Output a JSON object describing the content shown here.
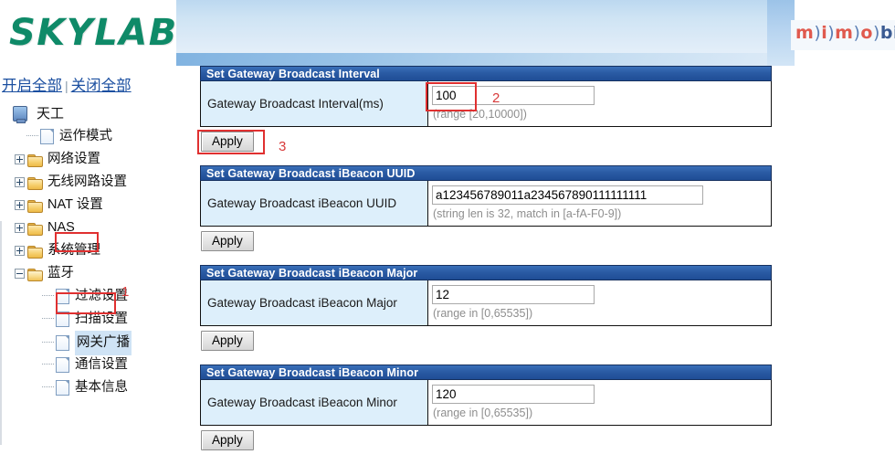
{
  "header": {
    "brand": "SKYLAB",
    "secondary_logo_text": "m)i)m)o)bi",
    "secondary_logo_parts": {
      "m1": "m",
      "p1": ")",
      "i": "i",
      "p2": ")",
      "m2": "m",
      "p3": ")",
      "o": "o",
      "p4": ")",
      "tail": "bi"
    }
  },
  "sidebar": {
    "expand_all_label": "开启全部",
    "separator": "|",
    "collapse_all_label": "关闭全部",
    "root": {
      "label": "天工",
      "icon": "computer-icon"
    },
    "items": [
      {
        "label": "运作模式",
        "icon": "page-icon",
        "level": 1,
        "expander": "none"
      },
      {
        "label": "网络设置",
        "icon": "folder-icon",
        "level": 1,
        "expander": "plus"
      },
      {
        "label": "无线网路设置",
        "icon": "folder-icon",
        "level": 1,
        "expander": "plus"
      },
      {
        "label": "NAT 设置",
        "icon": "folder-icon",
        "level": 1,
        "expander": "plus"
      },
      {
        "label": "NAS",
        "icon": "folder-icon",
        "level": 1,
        "expander": "plus"
      },
      {
        "label": "系统管理",
        "icon": "folder-icon",
        "level": 1,
        "expander": "plus"
      },
      {
        "label": "蓝牙",
        "icon": "folder-open-icon",
        "level": 1,
        "expander": "minus"
      },
      {
        "label": "过滤设置",
        "icon": "page-icon",
        "level": 2,
        "expander": "none"
      },
      {
        "label": "扫描设置",
        "icon": "page-icon",
        "level": 2,
        "expander": "none"
      },
      {
        "label": "网关广播",
        "icon": "page-icon",
        "level": 2,
        "expander": "none",
        "selected": true
      },
      {
        "label": "通信设置",
        "icon": "page-icon",
        "level": 2,
        "expander": "none"
      },
      {
        "label": "基本信息",
        "icon": "page-icon",
        "level": 2,
        "expander": "none"
      }
    ]
  },
  "annotations": {
    "marker1": "1",
    "marker2": "2",
    "marker3": "3",
    "box_color": "#e03030"
  },
  "panels": [
    {
      "title": "Set Gateway Broadcast Interval",
      "label": "Gateway Broadcast Interval(ms)",
      "value": "100",
      "hint": "(range [20,10000])",
      "apply_label": "Apply"
    },
    {
      "title": "Set Gateway Broadcast iBeacon UUID",
      "label": "Gateway Broadcast iBeacon UUID",
      "value": "a123456789011a234567890111111111",
      "hint": "(string len is 32, match in [a-fA-F0-9])",
      "apply_label": "Apply"
    },
    {
      "title": "Set Gateway Broadcast iBeacon Major",
      "label": "Gateway Broadcast iBeacon Major",
      "value": "12",
      "hint": "(range in [0,65535])",
      "apply_label": "Apply"
    },
    {
      "title": "Set Gateway Broadcast iBeacon Minor",
      "label": "Gateway Broadcast iBeacon Minor",
      "value": "120",
      "hint": "(range in [0,65535])",
      "apply_label": "Apply"
    }
  ],
  "colors": {
    "brand_green": "#0f8a68",
    "panel_header_blue": "#2a5ba4",
    "label_cell_blue": "#ddeffb",
    "link_blue": "#1b4fa0",
    "selection_blue": "#cfe3f5"
  }
}
